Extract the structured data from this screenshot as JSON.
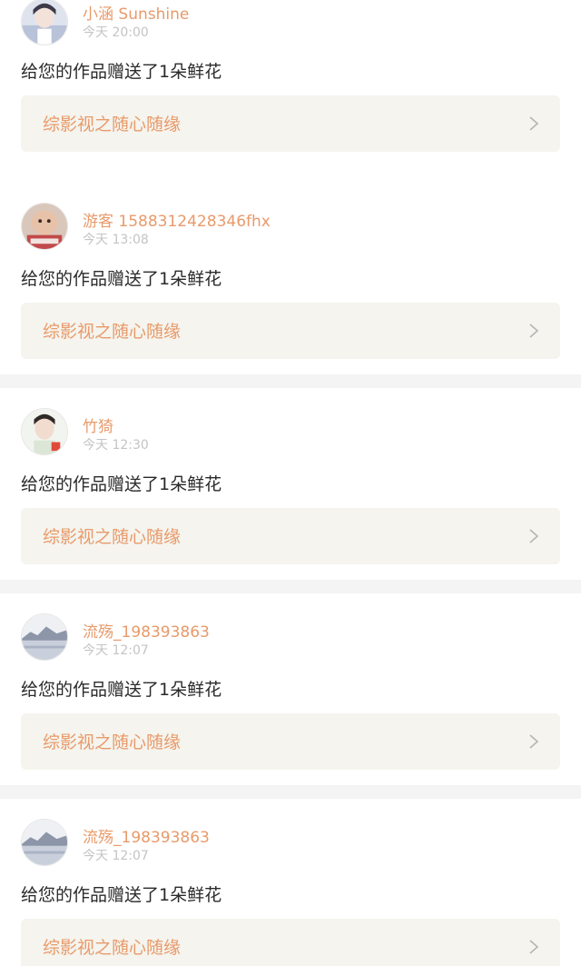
{
  "notifications": [
    {
      "username": "小涵 Sunshine",
      "time": "今天 20:00",
      "message": "给您的作品赠送了1朵鲜花",
      "work_title": "综影视之随心随缘",
      "avatar": "avatar-girl-portrait"
    },
    {
      "username": "游客 1588312428346fhx",
      "time": "今天 13:08",
      "message": "给您的作品赠送了1朵鲜花",
      "work_title": "综影视之随心随缘",
      "avatar": "avatar-baby-photo"
    },
    {
      "username": "竹猗",
      "time": "今天 12:30",
      "message": "给您的作品赠送了1朵鲜花",
      "work_title": "综影视之随心随缘",
      "avatar": "avatar-boy-portrait"
    },
    {
      "username": "流殇_198393863",
      "time": "今天 12:07",
      "message": "给您的作品赠送了1朵鲜花",
      "work_title": "综影视之随心随缘",
      "avatar": "avatar-landscape-lake"
    },
    {
      "username": "流殇_198393863",
      "time": "今天 12:07",
      "message": "给您的作品赠送了1朵鲜花",
      "work_title": "综影视之随心随缘",
      "avatar": "avatar-landscape-lake"
    }
  ],
  "colors": {
    "accent": "#e89a6a",
    "time_text": "#c4c4c4",
    "message_text": "#2a2a2a",
    "link_background": "#f5f4ee",
    "page_background": "#f4f4f4"
  },
  "icons": {
    "chevron": "chevron-right-icon"
  }
}
